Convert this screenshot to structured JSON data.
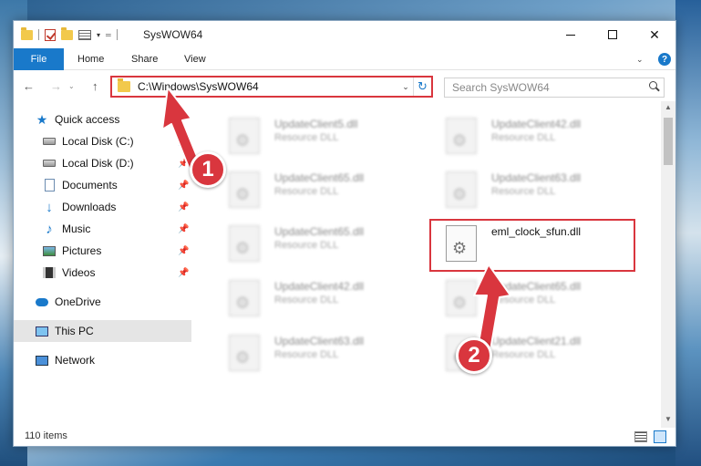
{
  "window": {
    "title": "SysWOW64",
    "minimize_label": "—",
    "close_label": "✕"
  },
  "ribbon": {
    "file": "File",
    "home": "Home",
    "share": "Share",
    "view": "View"
  },
  "nav": {
    "address": "C:\\Windows\\SysWOW64",
    "search_placeholder": "Search SysWOW64"
  },
  "sidebar": {
    "items": [
      {
        "label": "Quick access",
        "icon": "star-icon"
      },
      {
        "label": "Local Disk (C:)",
        "icon": "drive-icon",
        "pinned": true
      },
      {
        "label": "Local Disk (D:)",
        "icon": "drive-icon",
        "pinned": true
      },
      {
        "label": "Documents",
        "icon": "documents-icon",
        "pinned": true
      },
      {
        "label": "Downloads",
        "icon": "download-icon",
        "pinned": true
      },
      {
        "label": "Music",
        "icon": "music-icon",
        "pinned": true
      },
      {
        "label": "Pictures",
        "icon": "pictures-icon",
        "pinned": true
      },
      {
        "label": "Videos",
        "icon": "videos-icon",
        "pinned": true
      },
      {
        "label": "OneDrive",
        "icon": "onedrive-icon"
      },
      {
        "label": "This PC",
        "icon": "pc-icon",
        "selected": true
      },
      {
        "label": "Network",
        "icon": "network-icon"
      }
    ]
  },
  "files": [
    {
      "name": "UpdateClient5.dll",
      "type": "Resource DLL"
    },
    {
      "name": "UpdateClient42.dll",
      "type": "Resource DLL"
    },
    {
      "name": "UpdateClient65.dll",
      "type": "Resource DLL"
    },
    {
      "name": "UpdateClient63.dll",
      "type": "Resource DLL"
    },
    {
      "name": "UpdateClient65.dll",
      "type": "Resource DLL"
    },
    {
      "name": "eml_clock_sfun.dll",
      "type": ""
    },
    {
      "name": "UpdateClient42.dll",
      "type": "Resource DLL"
    },
    {
      "name": "UpdateClient65.dll",
      "type": "Resource DLL"
    },
    {
      "name": "UpdateClient63.dll",
      "type": "Resource DLL"
    },
    {
      "name": "UpdateClient21.dll",
      "type": "Resource DLL"
    }
  ],
  "status": {
    "item_count": "110 items"
  },
  "annotations": {
    "step1": "1",
    "step2": "2",
    "color": "#d9363e"
  }
}
